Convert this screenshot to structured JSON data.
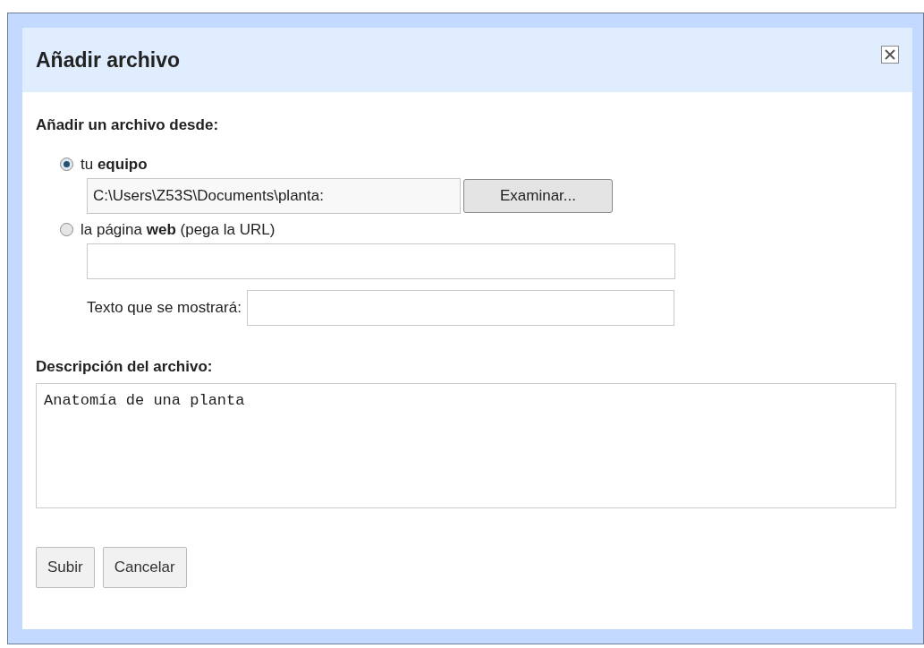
{
  "dialog": {
    "title": "Añadir archivo",
    "source_heading": "Añadir un archivo desde:",
    "sources": [
      {
        "kind": "file",
        "label": "tu **equipo**",
        "selected": true,
        "value": "C:\\Users\\Z53S\\Documents\\planta:",
        "button": "Examinar..."
      },
      {
        "kind": "url",
        "label": "la página **web** (pega la URL)",
        "selected": false,
        "display_text_label": "Texto que se mostrará:"
      }
    ],
    "description_heading": "Descripción del archivo:",
    "description": "Anatomía de una planta",
    "buttons": [
      "Subir",
      "Cancelar"
    ]
  }
}
